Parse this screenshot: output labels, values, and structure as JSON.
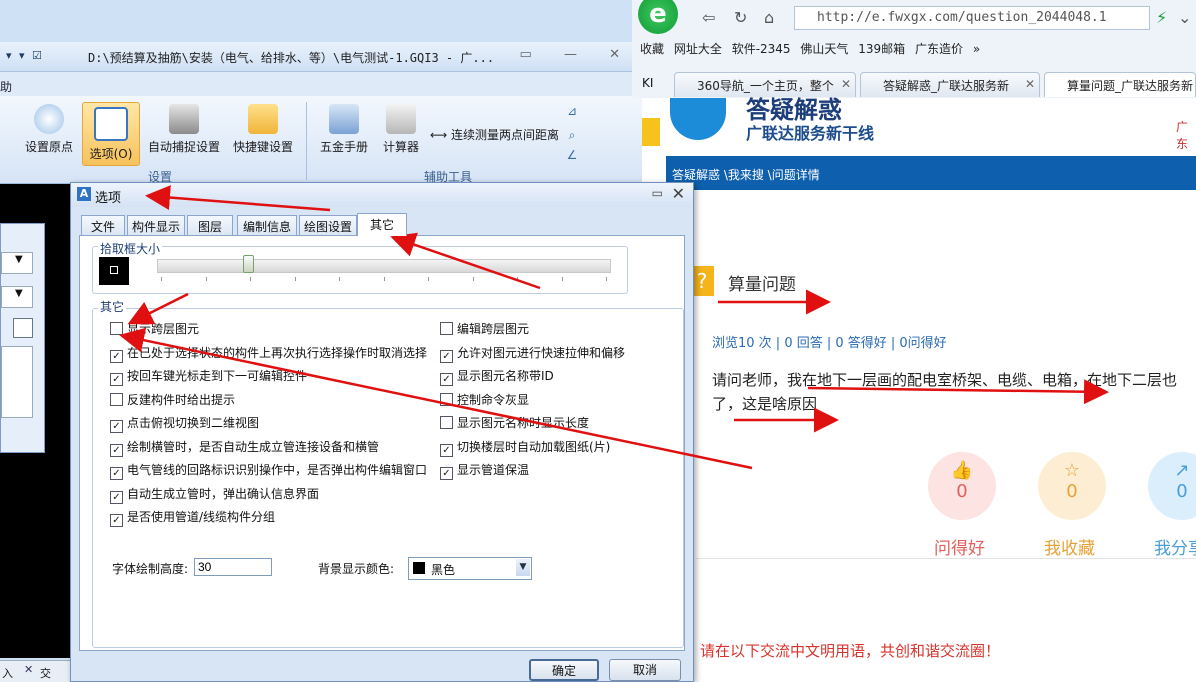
{
  "app": {
    "quick_access": "▾  ▾  ☑",
    "title_path": "D:\\预结算及抽筋\\安装（电气、给排水、等）\\电气测试-1.GQI3 - 广...",
    "window_controls": "▭  —  ✕",
    "menu_fragment": "助",
    "ribbon": {
      "set_origin": "设置原点",
      "options": "选项(O)",
      "auto_snap": "自动捕捉设置",
      "shortcuts": "快捷键设置",
      "hardware_manual": "五金手册",
      "calculator": "计算器",
      "measure_two_points": "连续测量两点间距离",
      "group_settings": "设置",
      "group_aux_tools": "辅助工具"
    },
    "status_left": "入",
    "status_cross": "交"
  },
  "browser": {
    "logo": "e",
    "address": "http://e.fwxgx.com/question_2044048.1",
    "bookmarks": [
      "收藏",
      "网址大全",
      "软件-2345",
      "佛山天气",
      "139邮箱",
      "广东造价"
    ],
    "tabs": [
      {
        "label": "360导航_一个主页，整个"
      },
      {
        "label": "答疑解惑_广联达服务新"
      },
      {
        "label": "算量问题_广联达服务新"
      }
    ],
    "tab_fragment": "KI",
    "page": {
      "site_name": "答疑解惑",
      "site_slogan": "广联达服务新干线",
      "right_fragment": "广东",
      "breadcrumb": "答疑解惑 \\我来搜 \\问题详情",
      "question_title": "算量问题",
      "stats": "浏览10 次 | 0 回答 | 0 答得好 | 0问得好",
      "body_line1": "请问老师，我在地下一层画的配电室桥架、电缆、电箱，在地下二层也",
      "body_line2": "了，这是啥原因",
      "actions": [
        {
          "count": "0",
          "label": "问得好",
          "color": "#e0625e",
          "bg": "#fde3e2"
        },
        {
          "count": "0",
          "label": "我收藏",
          "color": "#e6a236",
          "bg": "#fdeed3"
        },
        {
          "count": "0",
          "label": "我分享",
          "color": "#4a9ed8",
          "bg": "#dbeefb"
        }
      ],
      "notice": "请在以下交流中文明用语，共创和谐交流圈！"
    }
  },
  "dialog": {
    "title": "选项",
    "tabs": [
      "文件",
      "构件显示",
      "图层",
      "编制信息",
      "绘图设置",
      "其它"
    ],
    "active_tab": "其它",
    "pick_box_label": "拾取框大小",
    "pick_box_level": 0.2,
    "other_label": "其它",
    "left_options": [
      {
        "label": "显示跨层图元",
        "checked": false
      },
      {
        "label": "在已处于选择状态的构件上再次执行选择操作时取消选择",
        "checked": true
      },
      {
        "label": "按回车键光标走到下一可编辑控件",
        "checked": true
      },
      {
        "label": "反建构件时给出提示",
        "checked": false
      },
      {
        "label": "点击俯视切换到二维视图",
        "checked": true
      },
      {
        "label": "绘制横管时，是否自动生成立管连接设备和横管",
        "checked": true
      },
      {
        "label": "电气管线的回路标识识别操作中，是否弹出构件编辑窗口",
        "checked": true
      },
      {
        "label": "自动生成立管时，弹出确认信息界面",
        "checked": true
      },
      {
        "label": "是否使用管道/线缆构件分组",
        "checked": true
      }
    ],
    "right_options": [
      {
        "label": "编辑跨层图元",
        "checked": false
      },
      {
        "label": "允许对图元进行快速拉伸和偏移",
        "checked": true
      },
      {
        "label": "显示图元名称带ID",
        "checked": true
      },
      {
        "label": "控制命令灰显",
        "checked": false
      },
      {
        "label": "显示图元名称时显示长度",
        "checked": false
      },
      {
        "label": "切换楼层时自动加载图纸(片)",
        "checked": true
      },
      {
        "label": "显示管道保温",
        "checked": true
      }
    ],
    "font_height_label": "字体绘制高度:",
    "font_height_value": "30",
    "bg_color_label": "背景显示颜色:",
    "bg_color_value": "黑色",
    "ok": "确定",
    "cancel": "取消"
  },
  "colors": {
    "arrow": "#e01010",
    "dialog_bg": "#d8e5f5",
    "browser_blue": "#0e5fae"
  }
}
